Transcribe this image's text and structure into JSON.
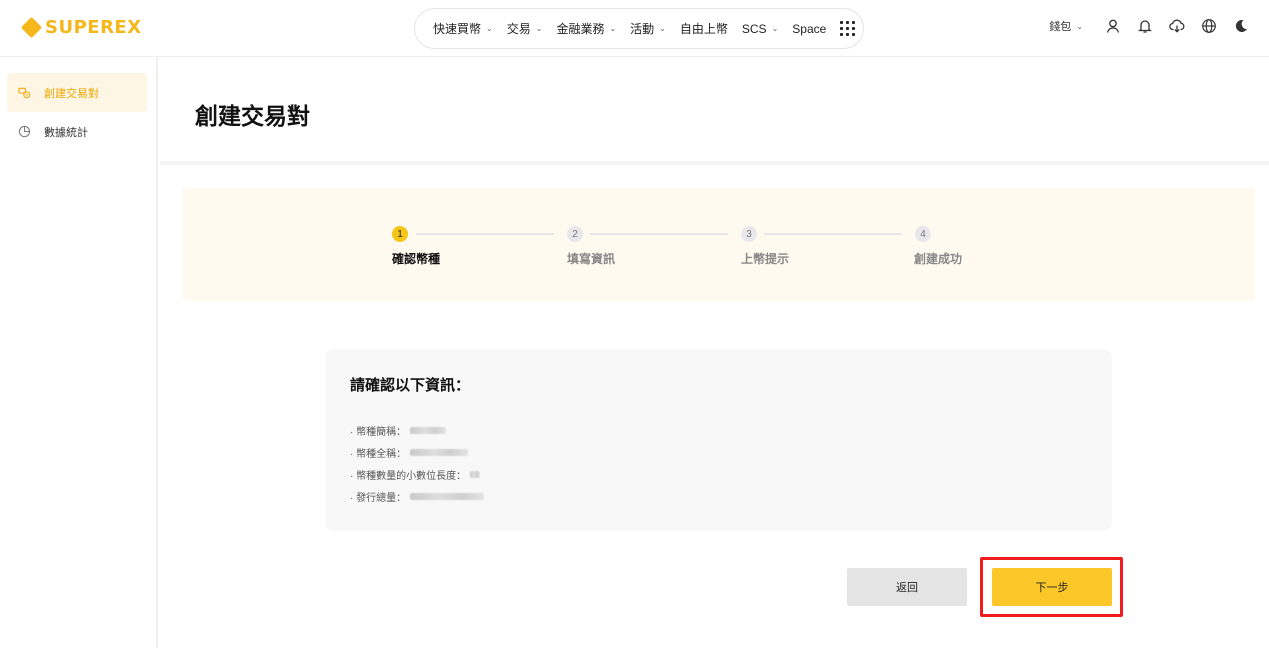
{
  "brand": {
    "name": "SUPEREX",
    "accent": "#f5b81c"
  },
  "nav": {
    "items": [
      {
        "label": "快速買幣",
        "has_dropdown": true
      },
      {
        "label": "交易",
        "has_dropdown": true
      },
      {
        "label": "金融業務",
        "has_dropdown": true
      },
      {
        "label": "活動",
        "has_dropdown": true
      },
      {
        "label": "自由上幣",
        "has_dropdown": false
      },
      {
        "label": "SCS",
        "has_dropdown": true
      },
      {
        "label": "Space",
        "has_dropdown": false
      }
    ],
    "more_icon": "grid-dots-icon"
  },
  "toolbar": {
    "wallet_label": "錢包",
    "icons": [
      "user-icon",
      "bell-icon",
      "download-icon",
      "globe-icon",
      "moon-icon"
    ]
  },
  "sidebar": {
    "items": [
      {
        "label": "創建交易對",
        "icon": "coins-icon",
        "active": true
      },
      {
        "label": "數據統計",
        "icon": "pie-chart-icon",
        "active": false
      }
    ]
  },
  "page": {
    "title": "創建交易對"
  },
  "stepper": {
    "steps": [
      {
        "number": "1",
        "label": "確認幣種",
        "state": "active"
      },
      {
        "number": "2",
        "label": "填寫資訊",
        "state": "todo"
      },
      {
        "number": "3",
        "label": "上幣提示",
        "state": "todo"
      },
      {
        "number": "4",
        "label": "創建成功",
        "state": "todo"
      }
    ]
  },
  "info": {
    "title": "請確認以下資訊：",
    "rows": [
      {
        "label": "· 幣種簡稱："
      },
      {
        "label": "· 幣種全稱："
      },
      {
        "label": "· 幣種數量的小數位長度："
      },
      {
        "label": "· 發行總量："
      }
    ]
  },
  "actions": {
    "back_label": "返回",
    "next_label": "下一步"
  },
  "colors": {
    "primary_button": "#fcc829",
    "highlight_border": "#ee1c1c",
    "active_step": "#f5c518"
  }
}
